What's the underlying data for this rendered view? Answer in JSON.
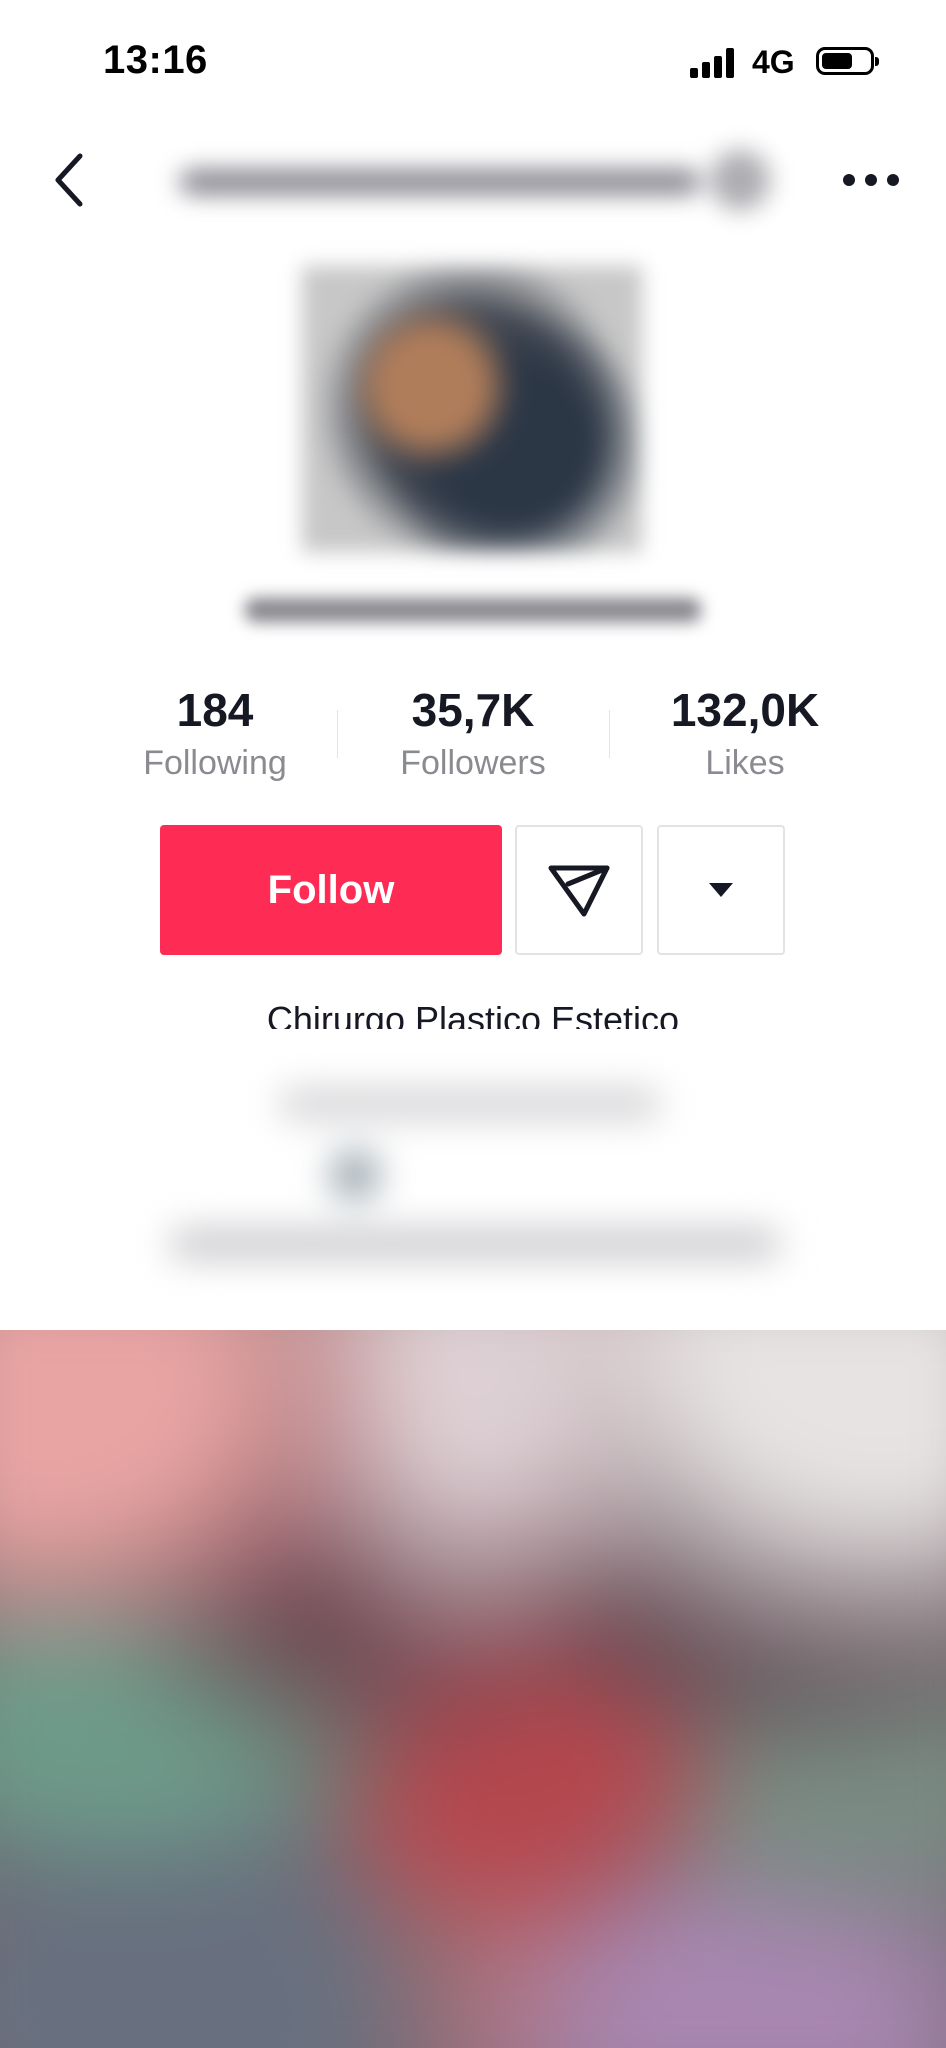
{
  "status_bar": {
    "time": "13:16",
    "network": "4G"
  },
  "profile": {
    "stats": [
      {
        "value": "184",
        "label": "Following"
      },
      {
        "value": "35,7K",
        "label": "Followers"
      },
      {
        "value": "132,0K",
        "label": "Likes"
      }
    ],
    "follow_label": "Follow",
    "bio_first_line": "Chirurgo Plastico Estetico"
  },
  "colors": {
    "follow_button": "#fe2c55",
    "text_primary": "#161823",
    "text_secondary": "#8a8b91"
  },
  "icons": {
    "back": "chevron-left",
    "more": "more-horizontal",
    "message": "send-paper-plane",
    "dropdown": "triangle-down"
  }
}
